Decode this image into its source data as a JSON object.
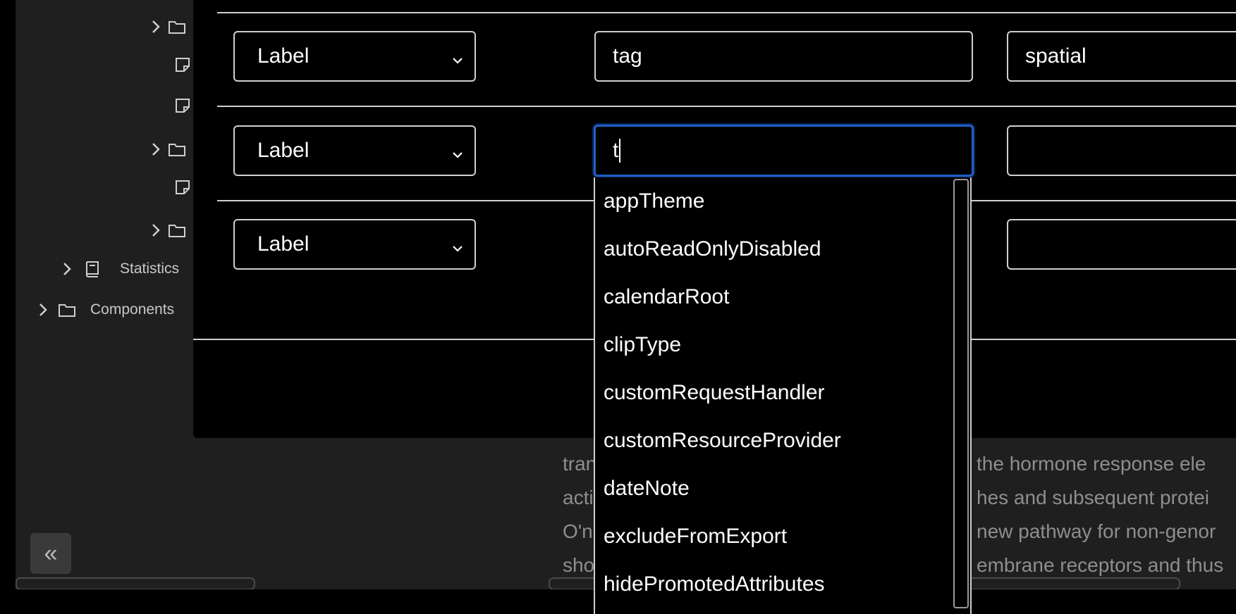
{
  "tree": {
    "items": [
      {
        "type": "folder",
        "expandable": true,
        "label": ""
      },
      {
        "type": "note",
        "expandable": false,
        "label": ""
      },
      {
        "type": "note",
        "expandable": false,
        "label": ""
      },
      {
        "type": "folder",
        "expandable": true,
        "label": ""
      },
      {
        "type": "note",
        "expandable": false,
        "label": ""
      },
      {
        "type": "folder",
        "expandable": true,
        "label": ""
      },
      {
        "type": "book",
        "expandable": true,
        "label": "Statistics"
      },
      {
        "type": "folder",
        "expandable": true,
        "label": "Components"
      }
    ]
  },
  "collapse_button": {
    "icon": "double-chevron-left-icon",
    "glyph": "«"
  },
  "note_text": [
    "tran",
    "the hormone response ele",
    "acti",
    "hes and subsequent protei",
    "O'n",
    "new pathway for non-genor",
    "sho",
    "embrane receptors and thus"
  ],
  "attributes": {
    "rows": [
      {
        "type": "Label",
        "name": "tag",
        "value": "spatial"
      },
      {
        "type": "Label",
        "name": "t",
        "value": ""
      },
      {
        "type": "Label",
        "name": "",
        "value": ""
      }
    ]
  },
  "autocomplete": {
    "options": [
      "appTheme",
      "autoReadOnlyDisabled",
      "calendarRoot",
      "clipType",
      "customRequestHandler",
      "customResourceProvider",
      "dateNote",
      "excludeFromExport",
      "hidePromotedAttributes"
    ]
  }
}
